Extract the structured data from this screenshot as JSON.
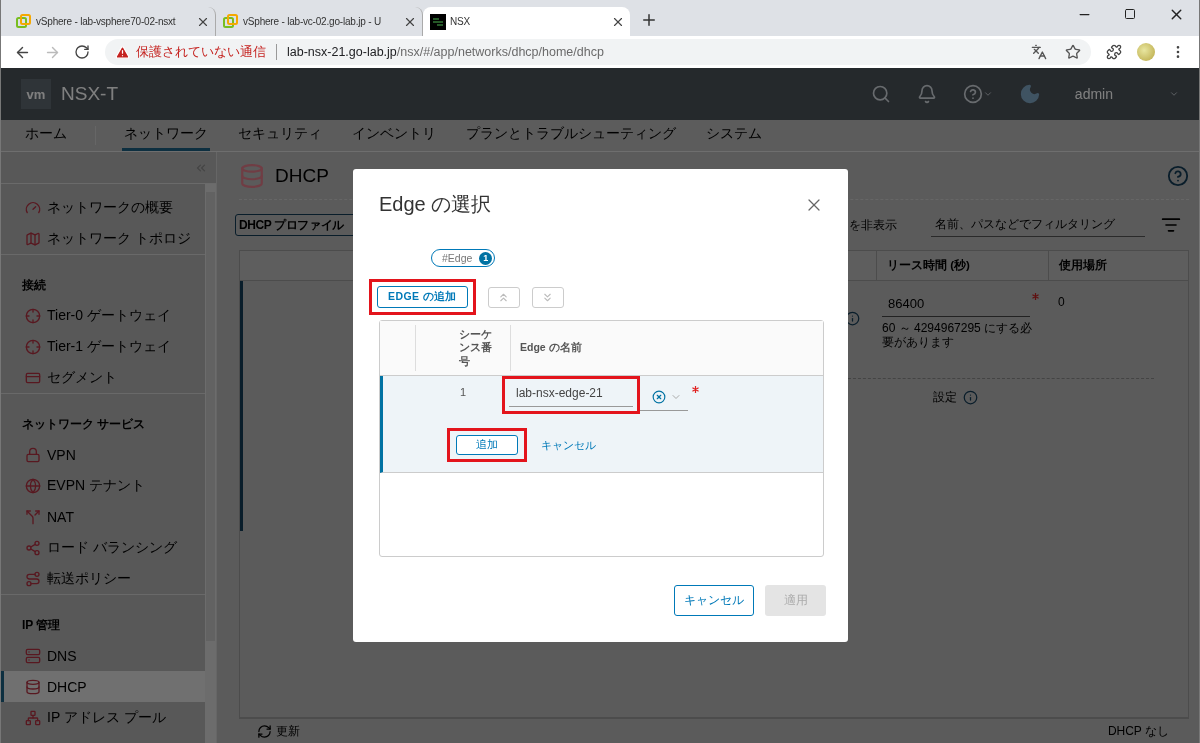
{
  "browser": {
    "tabs": [
      {
        "title": "vSphere - lab-vsphere70-02-nsxt",
        "selected": false,
        "kind": "vsphere"
      },
      {
        "title": "vSphere - lab-vc-02.go-lab.jp - U",
        "selected": false,
        "kind": "vsphere"
      },
      {
        "title": "NSX",
        "selected": true,
        "kind": "nsx"
      }
    ],
    "address": {
      "warning": "保護されていない通信",
      "host": "lab-nsx-21.go-lab.jp",
      "path": "/nsx/#/app/networks/dhcp/home/dhcp"
    }
  },
  "app": {
    "logo": "vm",
    "product": "NSX-T",
    "user": "admin",
    "nav": [
      {
        "label": "ホーム",
        "selected": false
      },
      {
        "label": "ネットワーク",
        "selected": true
      },
      {
        "label": "セキュリティ",
        "selected": false
      },
      {
        "label": "インベントリ",
        "selected": false
      },
      {
        "label": "プランとトラブルシューティング",
        "selected": false
      },
      {
        "label": "システム",
        "selected": false
      }
    ]
  },
  "sidebar": {
    "sections": [
      {
        "items": [
          {
            "label": "ネットワークの概要",
            "selected": false
          },
          {
            "label": "ネットワーク トポロジ",
            "selected": false
          }
        ]
      },
      {
        "heading": "接続",
        "items": [
          {
            "label": "Tier-0 ゲートウェイ",
            "selected": false
          },
          {
            "label": "Tier-1 ゲートウェイ",
            "selected": false
          },
          {
            "label": "セグメント",
            "selected": false
          }
        ]
      },
      {
        "heading": "ネットワーク サービス",
        "items": [
          {
            "label": "VPN",
            "selected": false
          },
          {
            "label": "EVPN テナント",
            "selected": false
          },
          {
            "label": "NAT",
            "selected": false
          },
          {
            "label": "ロード バランシング",
            "selected": false
          },
          {
            "label": "転送ポリシー",
            "selected": false
          }
        ]
      },
      {
        "heading": "IP 管理",
        "items": [
          {
            "label": "DNS",
            "selected": false
          },
          {
            "label": "DHCP",
            "selected": true
          },
          {
            "label": "IP アドレス プール",
            "selected": false
          }
        ]
      }
    ]
  },
  "main": {
    "title": "DHCP",
    "profile_button": "DHCP プロファイル",
    "hide_link": "を非表示",
    "filter_placeholder": "名前、パスなどでフィルタリング",
    "columns": [
      "リース時間 (秒)",
      "使用場所"
    ],
    "row": {
      "lease": "86400",
      "lease_required": true,
      "lease_hint": "60 ～ 4294967295 にする必要があります",
      "usage": "0",
      "settings": "設定"
    },
    "refresh": "更新",
    "footer": "DHCP なし"
  },
  "modal": {
    "title": "Edge の選択",
    "tag": {
      "label": "#Edge",
      "count": "1"
    },
    "add_button": {
      "label": "EDGE の追加",
      "highlighted": true
    },
    "columns": [
      "シーケンス番号",
      "Edge の名前"
    ],
    "rows": [
      {
        "sequence": "1",
        "edge_name": "lab-nsx-edge-21",
        "required": true,
        "name_highlighted": true,
        "selected": true
      }
    ],
    "row_add": {
      "label": "追加",
      "highlighted": true
    },
    "row_cancel": "キャンセル",
    "cancel": "キャンセル",
    "apply": {
      "label": "適用",
      "disabled": true
    }
  }
}
